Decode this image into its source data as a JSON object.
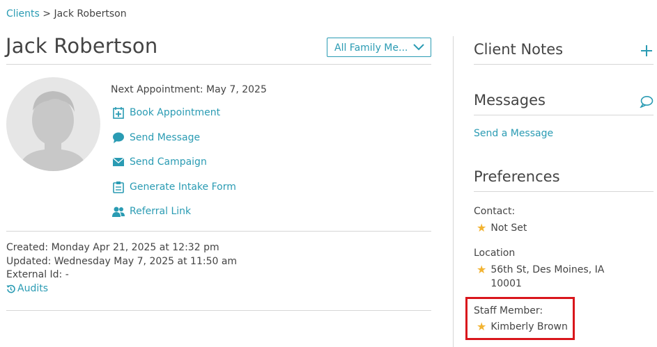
{
  "breadcrumb": {
    "root": "Clients",
    "separator": ">",
    "current": "Jack Robertson"
  },
  "client": {
    "name": "Jack Robertson"
  },
  "family_select": {
    "value": "All Family Me..."
  },
  "appointment": {
    "label": "Next Appointment:",
    "value": "May 7, 2025"
  },
  "actions": {
    "book": "Book Appointment",
    "message": "Send Message",
    "campaign": "Send Campaign",
    "intake": "Generate Intake Form",
    "referral": "Referral Link"
  },
  "meta": {
    "created": "Created: Monday Apr 21, 2025 at 12:32 pm",
    "updated": "Updated: Wednesday May 7, 2025 at 11:50 am",
    "external_id": "External Id: -",
    "audits": "Audits"
  },
  "sidebar": {
    "notes_title": "Client Notes",
    "messages_title": "Messages",
    "send_message_link": "Send a Message",
    "preferences_title": "Preferences",
    "contact_label": "Contact:",
    "contact_value": "Not Set",
    "location_label": "Location",
    "location_line1": "56th St, Des Moines, IA",
    "location_line2": "10001",
    "staff_label": "Staff Member:",
    "staff_value": "Kimberly Brown"
  },
  "colors": {
    "accent": "#2a9bb3",
    "star": "#f2b331",
    "highlight": "#d9161c",
    "text": "#444444",
    "divider": "#d6d6d6"
  },
  "icons": [
    "calendar-plus-icon",
    "chat-bubble-icon",
    "envelope-icon",
    "clipboard-icon",
    "people-icon",
    "history-icon",
    "plus-icon",
    "star-icon",
    "chevron-down-icon"
  ]
}
